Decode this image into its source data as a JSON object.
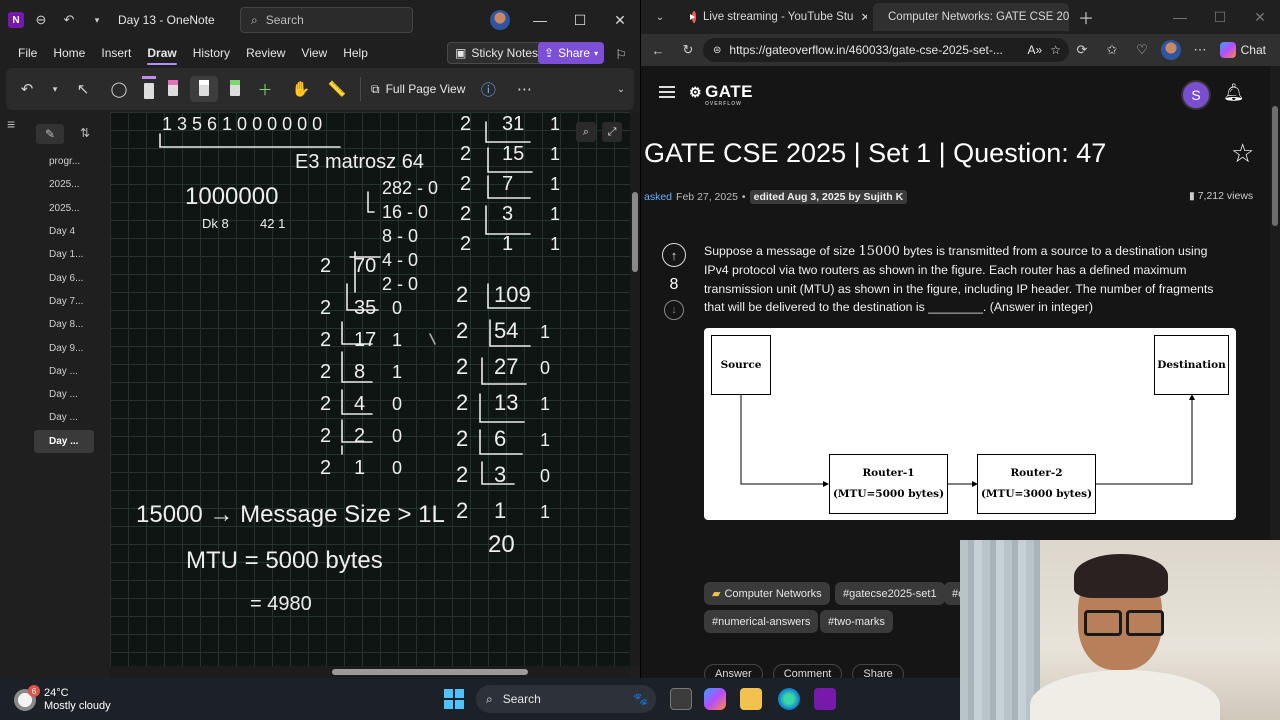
{
  "onenote": {
    "title": "Day 13 - OneNote",
    "search_placeholder": "Search",
    "menu": [
      "File",
      "Home",
      "Insert",
      "Draw",
      "History",
      "Review",
      "View",
      "Help"
    ],
    "active_menu": "Draw",
    "sticky_notes": "Sticky Notes",
    "share": "Share",
    "full_page_view": "Full Page View",
    "pages": [
      "progr...",
      "2025...",
      "2025...",
      "Day 4",
      "Day 1...",
      "Day 6...",
      "Day 7...",
      "Day 8...",
      "Day 9...",
      "Day ...",
      "Day ...",
      "Day ...",
      "Day ..."
    ],
    "active_page_index": 12,
    "ink": {
      "top": "1 3 5 6 1 0 0 0 0 0 0",
      "e3": "E3 matrosz 64",
      "big_num": "1000000",
      "sub_a": "Dk 8",
      "sub_b": "42 1",
      "msg_line": "15000 → Message Size > 1L",
      "mtu_line": "MTU = 5000 bytes",
      "result": "= 4980",
      "twenty": "20",
      "div_left": [
        "282 - 0",
        "16 - 0",
        "8 - 0",
        "4 - 0",
        "2 - 0"
      ],
      "div_col2": [
        {
          "q": "70",
          "r": ""
        },
        {
          "q": "35",
          "r": "0"
        },
        {
          "q": "17",
          "r": "1"
        },
        {
          "q": "8",
          "r": "1"
        },
        {
          "q": "4",
          "r": "0"
        },
        {
          "q": "2",
          "r": "0"
        },
        {
          "q": "1",
          "r": "0"
        }
      ],
      "div_right_top": [
        {
          "q": "31",
          "r": "1"
        },
        {
          "q": "15",
          "r": "1"
        },
        {
          "q": "7",
          "r": "1"
        },
        {
          "q": "3",
          "r": "1"
        },
        {
          "q": "1",
          "r": "1"
        }
      ],
      "div_right_bottom": [
        {
          "q": "109",
          "r": ""
        },
        {
          "q": "54",
          "r": "1"
        },
        {
          "q": "27",
          "r": "0"
        },
        {
          "q": "13",
          "r": "1"
        },
        {
          "q": "6",
          "r": "1"
        },
        {
          "q": "3",
          "r": "0"
        },
        {
          "q": "1",
          "r": "1"
        }
      ]
    }
  },
  "edge": {
    "tabs": [
      {
        "title": "Live streaming - YouTube Stu",
        "active": false
      },
      {
        "title": "Computer Networks: GATE CSE 20",
        "active": true
      }
    ],
    "url": "https://gateoverflow.in/460033/gate-cse-2025-set-...",
    "chat_label": "Chat",
    "site": {
      "logo": "GATE",
      "logo_sub": "OVERFLOW",
      "user_initial": "S",
      "title": "GATE CSE 2025 | Set 1 | Question: 47",
      "meta": {
        "asked": "asked",
        "asked_date": "Feb 27, 2025",
        "edited": "edited Aug 3, 2025 by",
        "editor": "Sujith K",
        "views": "7,212 views"
      },
      "votes": "8",
      "question_parts": {
        "a": "Suppose a message of size ",
        "size": "15000",
        "b": " bytes is transmitted from a source to a destination using IPv4 protocol via two routers as shown in the figure. Each router has a defined maximum transmission unit (MTU) as shown in the figure, including IP header. The number of fragments that will be delivered to the destination is ________. (Answer in integer)"
      },
      "figure": {
        "source": "Source",
        "destination": "Destination",
        "router1": "Router-1",
        "router1_mtu": "(MTU=5000 bytes)",
        "router2": "Router-2",
        "router2_mtu": "(MTU=3000 bytes)"
      },
      "tags": [
        "Computer Networks",
        "#gatecse2025-set1",
        "#c",
        "#numerical-answers",
        "#two-marks"
      ],
      "actions": [
        "Answer",
        "Comment",
        "Share"
      ]
    }
  },
  "taskbar": {
    "temp": "24°C",
    "weather": "Mostly cloudy",
    "weather_badge": "6",
    "search": "Search"
  }
}
